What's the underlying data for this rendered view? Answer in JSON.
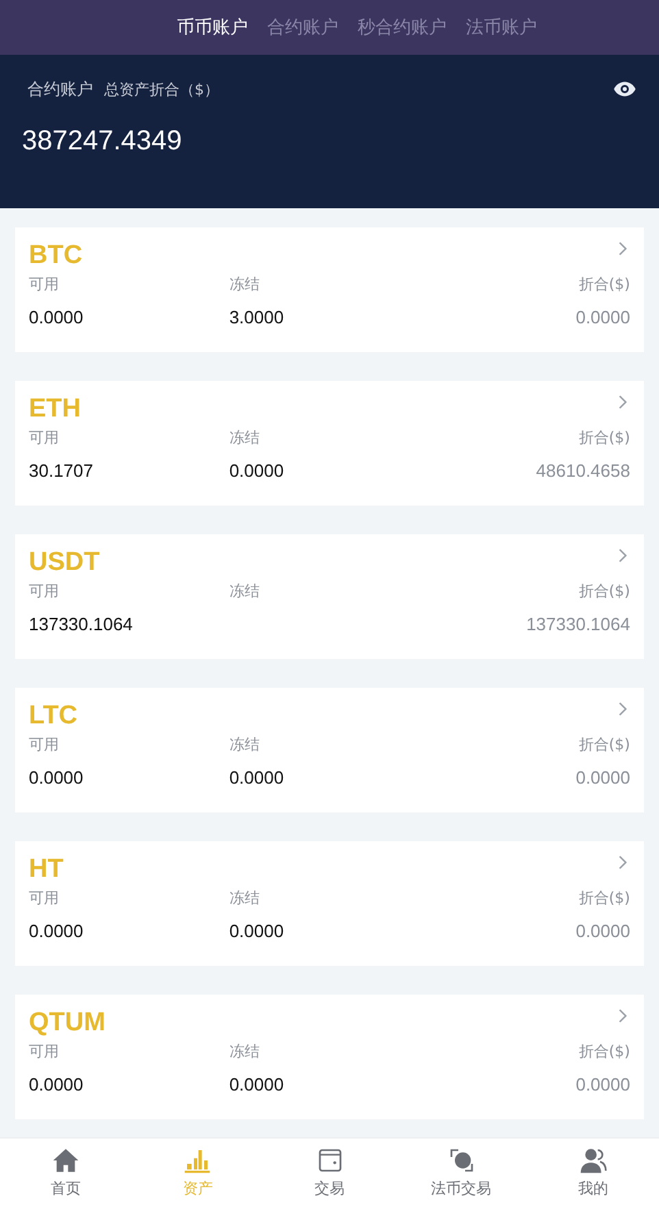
{
  "tabs": [
    {
      "label": "币币账户",
      "selected": true
    },
    {
      "label": "合约账户",
      "selected": false
    },
    {
      "label": "秒合约账户",
      "selected": false
    },
    {
      "label": "法币账户",
      "selected": false
    }
  ],
  "summary": {
    "account": "合约账户",
    "caption": "总资产折合（$）",
    "total": "387247.4349"
  },
  "assets": [
    {
      "name": "BTC",
      "available_label": "可用",
      "available": "0.0000",
      "frozen_label": "冻结",
      "frozen": "3.0000",
      "value_label": "折合($)",
      "value": "0.0000"
    },
    {
      "name": "ETH",
      "available_label": "可用",
      "available": "30.1707",
      "frozen_label": "冻结",
      "frozen": "0.0000",
      "value_label": "折合($)",
      "value": "48610.4658"
    },
    {
      "name": "USDT",
      "available_label": "可用",
      "available": "137330.1064",
      "frozen_label": "冻结",
      "value_label": "折合($)",
      "value": "137330.1064"
    },
    {
      "name": "LTC",
      "available_label": "可用",
      "available": "0.0000",
      "frozen_label": "冻结",
      "frozen": "0.0000",
      "value_label": "折合($)",
      "value": "0.0000"
    },
    {
      "name": "HT",
      "available_label": "可用",
      "available": "0.0000",
      "frozen_label": "冻结",
      "frozen": "0.0000",
      "value_label": "折合($)",
      "value": "0.0000"
    },
    {
      "name": "QTUM",
      "available_label": "可用",
      "available": "0.0000",
      "frozen_label": "冻结",
      "frozen": "0.0000",
      "value_label": "折合($)",
      "value": "0.0000"
    }
  ],
  "nav": [
    {
      "kind": "home",
      "label": "首页",
      "selected": false
    },
    {
      "kind": "assets",
      "label": "资产",
      "selected": true
    },
    {
      "kind": "trade",
      "label": "交易",
      "selected": false
    },
    {
      "kind": "fiat",
      "label": "法币交易",
      "selected": false
    },
    {
      "kind": "profile",
      "label": "我的",
      "selected": false
    }
  ]
}
